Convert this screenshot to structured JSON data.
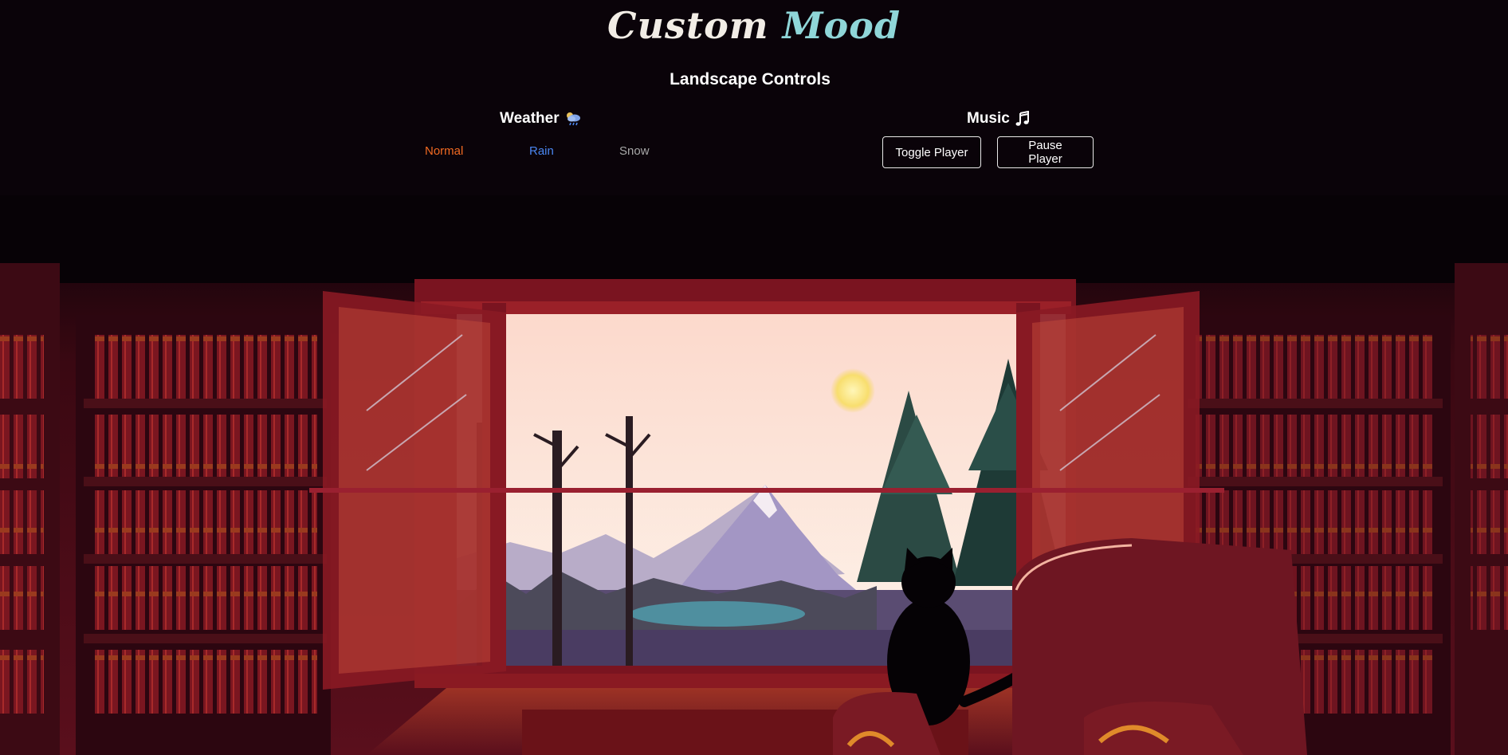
{
  "header": {
    "logo_word1": "Custom",
    "logo_word2": "Mood",
    "section_title": "Landscape Controls"
  },
  "weather": {
    "title": "Weather",
    "icon": "rain-cloud-icon",
    "options": [
      "Normal",
      "Rain",
      "Snow"
    ],
    "option_colors": [
      "#f26a22",
      "#4a86f0",
      "#a8a8a8"
    ]
  },
  "music": {
    "title": "Music",
    "icon": "music-note-icon",
    "toggle_label": "Toggle Player",
    "pause_label": "Pause Player"
  },
  "colors": {
    "background": "#0a0309",
    "logo_accent": "#8fd6d8",
    "room": "#5a0f1c",
    "sky": "#fbe3d3"
  }
}
